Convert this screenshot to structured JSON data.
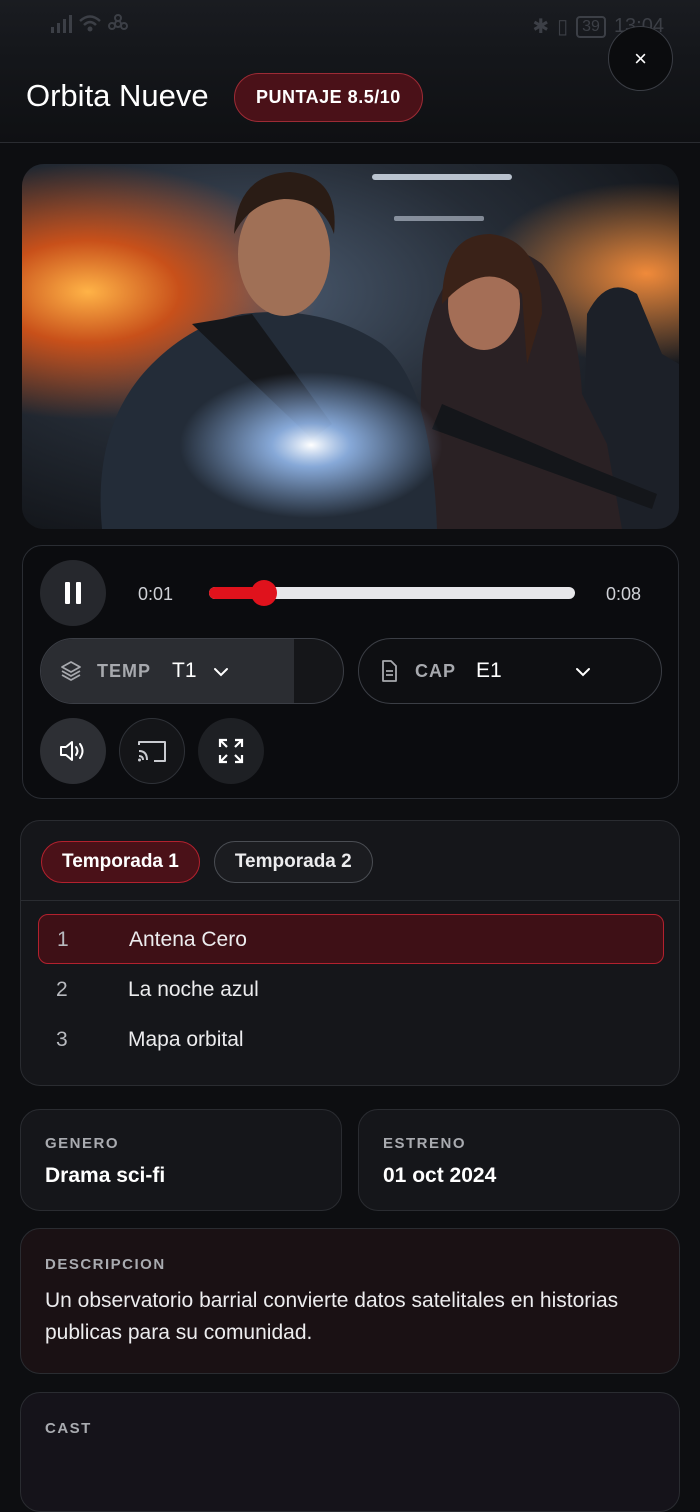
{
  "status_bar": {
    "time": "13:04",
    "battery": "39"
  },
  "header": {
    "title": "Orbita Nueve",
    "score_badge": "PUNTAJE 8.5/10",
    "close_symbol": "×"
  },
  "hero": {
    "alt": "Escena de accion con dos personajes armados"
  },
  "player": {
    "current_time": "0:01",
    "duration": "0:08",
    "progress_fraction": 0.15,
    "season_selector": {
      "label": "TEMP",
      "value": "T1"
    },
    "episode_selector": {
      "label": "CAP",
      "value": "E1"
    },
    "icons": [
      "pause-icon",
      "layers-icon",
      "chevron-down-icon",
      "document-icon",
      "volume-icon",
      "cast-icon",
      "fullscreen-icon"
    ]
  },
  "episodes": {
    "tabs": [
      "Temporada 1",
      "Temporada 2"
    ],
    "items": [
      {
        "number": "1",
        "title": "Antena Cero"
      },
      {
        "number": "2",
        "title": "La noche azul"
      },
      {
        "number": "3",
        "title": "Mapa orbital"
      }
    ]
  },
  "details": {
    "genre_label": "GENERO",
    "genre_value": "Drama sci-fi",
    "release_label": "ESTRENO",
    "release_value": "01 oct 2024",
    "description_label": "DESCRIPCION",
    "description_text": "Un observatorio barrial convierte datos satelitales en historias publicas para su comunidad.",
    "cast_label": "CAST"
  },
  "colors": {
    "accent_red": "#e0121c",
    "badge_bg": "#4a1118",
    "background": "#0d0e11"
  }
}
